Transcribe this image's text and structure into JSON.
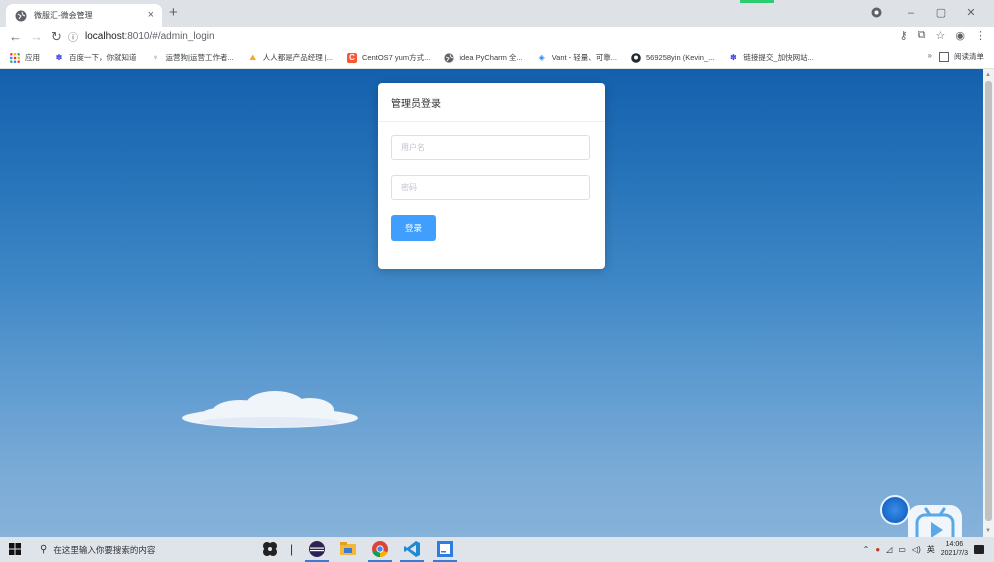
{
  "browser": {
    "tab_title": "微服汇-微会管理",
    "tab_close": "×",
    "new_tab": "+",
    "url_host": "localhost",
    "url_rest": ":8010/#/admin_login",
    "window_controls": [
      "–",
      "▢",
      "✕"
    ]
  },
  "bookmarks": {
    "items": [
      {
        "label": "应用",
        "icon": "apps-grid-icon",
        "color": "#e53935"
      },
      {
        "label": "百度一下，你就知道",
        "icon": "baidu-icon",
        "color": "#2932e1"
      },
      {
        "label": "运营狗|运营工作者...",
        "icon": "trophy-icon",
        "color": "#7a8b99"
      },
      {
        "label": "人人都是产品经理 |...",
        "icon": "pm-icon",
        "color": "#f5a623"
      },
      {
        "label": "CentOS7 yum方式...",
        "icon": "csdn-icon",
        "color": "#fc5531"
      },
      {
        "label": "idea PyCharm 全...",
        "icon": "globe-icon",
        "color": "#5f6368"
      },
      {
        "label": "Vant - 轻量、可靠...",
        "icon": "vant-icon",
        "color": "#1989fa"
      },
      {
        "label": "569258yin (Kevin_...",
        "icon": "github-icon",
        "color": "#24292e"
      },
      {
        "label": "链接提交_加快网站...",
        "icon": "baidu-icon",
        "color": "#2932e1"
      }
    ],
    "more": "»",
    "reading_list": "阅读清单"
  },
  "login": {
    "title": "管理员登录",
    "username_placeholder": "用户名",
    "password_placeholder": "密码",
    "submit": "登录"
  },
  "taskbar": {
    "search_placeholder": "在这里输入你要搜索的内容",
    "tray_lang": "英",
    "clock_time": "14:06",
    "clock_date": "2021/7/3",
    "accent": "#3c7ad6"
  },
  "colors": {
    "sky_top": "#1460ad",
    "sky_bottom": "#86b2d9",
    "primary_button": "#409eff"
  }
}
